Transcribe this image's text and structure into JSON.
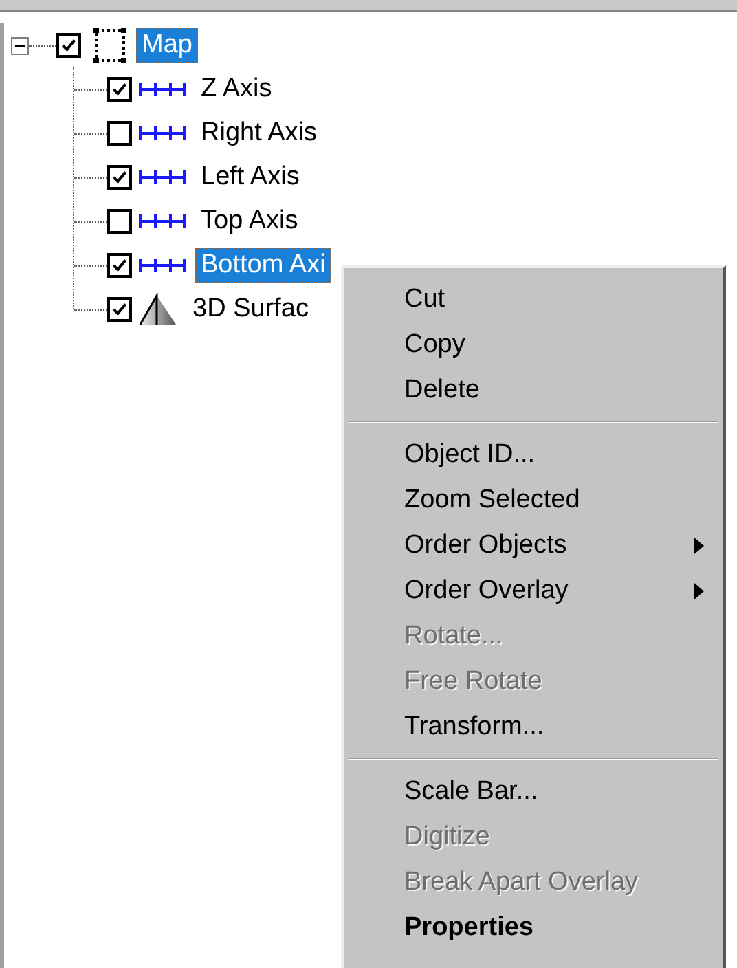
{
  "tree": {
    "label": "Map",
    "kind": "map",
    "checked": true,
    "selected": true,
    "expanded": true,
    "children": [
      {
        "label": "Z Axis",
        "kind": "axis",
        "checked": true,
        "selected": false
      },
      {
        "label": "Right Axis",
        "kind": "axis",
        "checked": false,
        "selected": false
      },
      {
        "label": "Left Axis",
        "kind": "axis",
        "checked": true,
        "selected": false
      },
      {
        "label": "Top Axis",
        "kind": "axis",
        "checked": false,
        "selected": false
      },
      {
        "label": "Bottom Axi",
        "kind": "axis",
        "checked": true,
        "selected": true
      },
      {
        "label": "3D Surfac",
        "kind": "surface",
        "checked": true,
        "selected": false
      }
    ]
  },
  "context_menu": {
    "items": [
      {
        "kind": "item",
        "label": "Cut",
        "disabled": false
      },
      {
        "kind": "item",
        "label": "Copy",
        "disabled": false
      },
      {
        "kind": "item",
        "label": "Delete",
        "disabled": false
      },
      {
        "kind": "separator"
      },
      {
        "kind": "item",
        "label": "Object ID...",
        "disabled": false
      },
      {
        "kind": "item",
        "label": "Zoom Selected",
        "disabled": false
      },
      {
        "kind": "submenu",
        "label": "Order Objects",
        "disabled": false
      },
      {
        "kind": "submenu",
        "label": "Order Overlay",
        "disabled": false
      },
      {
        "kind": "item",
        "label": "Rotate...",
        "disabled": true
      },
      {
        "kind": "item",
        "label": "Free Rotate",
        "disabled": true
      },
      {
        "kind": "item",
        "label": "Transform...",
        "disabled": false
      },
      {
        "kind": "separator"
      },
      {
        "kind": "item",
        "label": "Scale Bar...",
        "disabled": false
      },
      {
        "kind": "item",
        "label": "Digitize",
        "disabled": true
      },
      {
        "kind": "item",
        "label": "Break Apart Overlay",
        "disabled": true
      },
      {
        "kind": "default",
        "label": "Properties",
        "disabled": false
      }
    ]
  }
}
